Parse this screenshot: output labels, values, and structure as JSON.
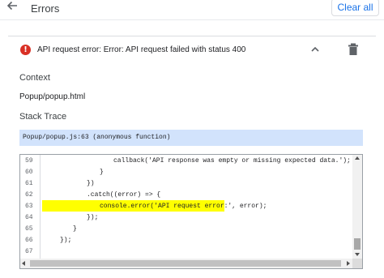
{
  "header": {
    "title": "Errors",
    "back_icon": "arrow-left-icon",
    "clear_label": "Clear all"
  },
  "error": {
    "icon": "error-circle-icon",
    "message": "API request error: Error: API request failed with status 400",
    "collapse_icon": "chevron-up-icon",
    "delete_icon": "trash-icon"
  },
  "details": {
    "context_label": "Context",
    "context_value": "Popup/popup.html",
    "stack_label": "Stack Trace",
    "stack_frame": "Popup/popup.js:63 (anonymous function)"
  },
  "code": {
    "lines": [
      {
        "n": "59",
        "text": "callback('API response was empty or missing expected data.');"
      },
      {
        "n": "60",
        "text": "}"
      },
      {
        "n": "61",
        "text": "})"
      },
      {
        "n": "62",
        "text": ".catch((error) => {"
      },
      {
        "n": "63",
        "text": "console.error('API request error:', error);"
      },
      {
        "n": "64",
        "text": "});"
      },
      {
        "n": "65",
        "text": "}"
      },
      {
        "n": "66",
        "text": "});"
      },
      {
        "n": "67",
        "text": ""
      }
    ],
    "highlight_line": "63",
    "highlight_color": "#ffff00"
  },
  "colors": {
    "accent": "#1a73e8",
    "error": "#d93025",
    "trace_bg": "#d2e3fc"
  }
}
